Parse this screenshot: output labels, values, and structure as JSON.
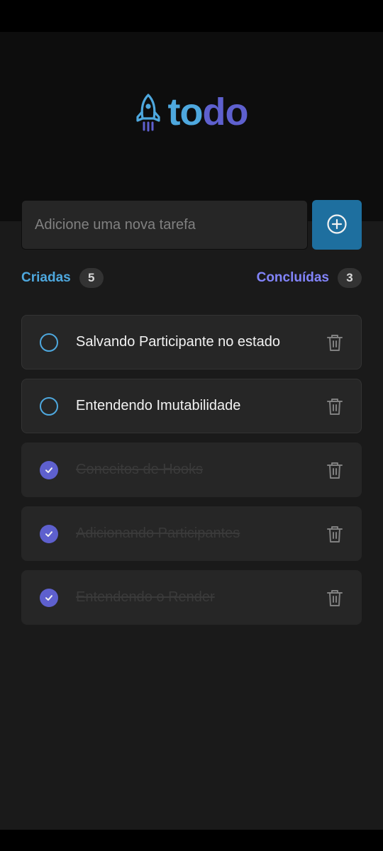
{
  "colors": {
    "blue": "#4ea8de",
    "purple": "#5e60ce",
    "purple_light": "#8284fa",
    "blue_dark": "#1e6f9f"
  },
  "app": {
    "logo_part1": "to",
    "logo_part2": "do"
  },
  "new_task": {
    "placeholder": "Adicione uma nova tarefa",
    "value": "",
    "add_icon": "plus-circle-icon"
  },
  "counters": {
    "created_label": "Criadas",
    "created_count": "5",
    "done_label": "Concluídas",
    "done_count": "3"
  },
  "tasks": [
    {
      "text": "Salvando Participante no estado",
      "done": false
    },
    {
      "text": "Entendendo Imutabilidade",
      "done": false
    },
    {
      "text": "Conceitos de Hooks",
      "done": true
    },
    {
      "text": "Adicionando Participantes",
      "done": true
    },
    {
      "text": "Entendendo o Render",
      "done": true
    }
  ]
}
